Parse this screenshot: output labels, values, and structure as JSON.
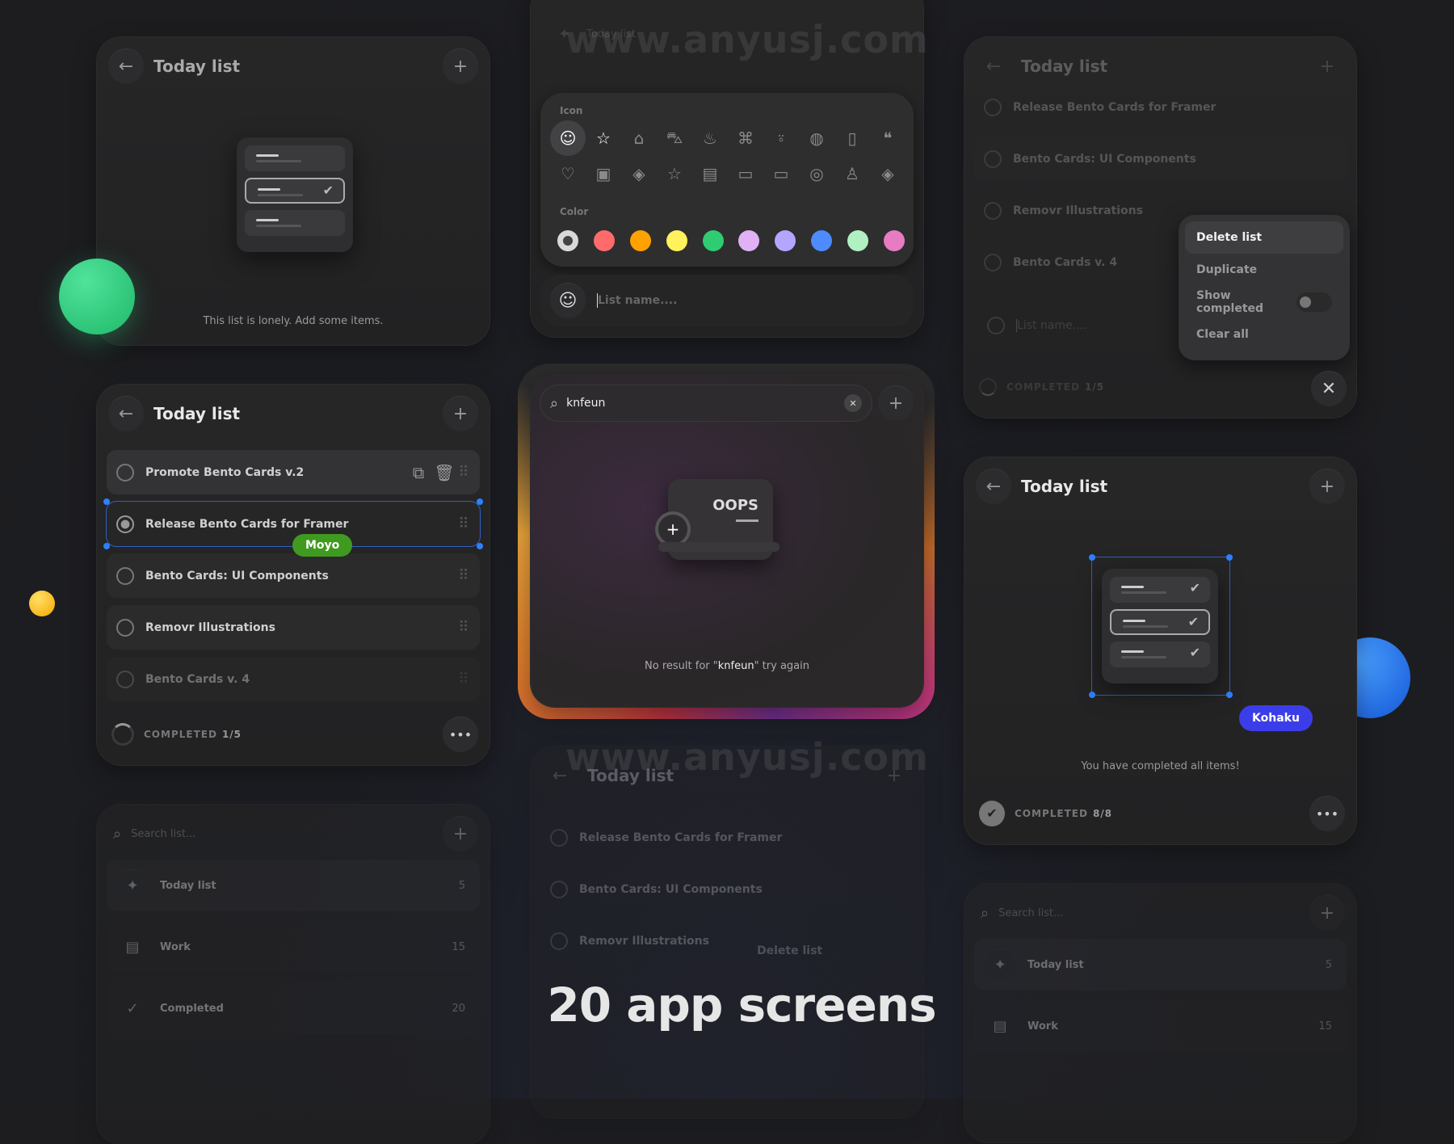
{
  "common": {
    "list_title": "Today list",
    "back_icon": "arrow-left-icon",
    "add_icon": "plus-icon",
    "more_icon": "ellipsis-icon"
  },
  "empty_card": {
    "message": "This list is lonely. Add some items."
  },
  "picker": {
    "header_title": "Today list",
    "icon_label": "Icon",
    "color_label": "Color",
    "icons": [
      "smile",
      "star",
      "home",
      "car",
      "flame",
      "command",
      "user-check",
      "planet",
      "sd-card",
      "quote",
      "heart",
      "image",
      "compass",
      "star-outline",
      "sticky-note",
      "laptop",
      "laptop-2",
      "disc",
      "user",
      "compass-2"
    ],
    "colors": [
      "#d9d9d9",
      "#ff6b6b",
      "#ffa200",
      "#fff25c",
      "#2fcc71",
      "#e0b2f5",
      "#b3a6ff",
      "#4d8bff",
      "#b1f0c1",
      "#e77cc2"
    ],
    "selected_icon": "smile",
    "name_placeholder": "List name...."
  },
  "menu_card": {
    "items": [
      "Release Bento Cards for Framer",
      "Bento Cards: UI Components",
      "Removr Illustrations",
      "Bento Cards v. 4"
    ],
    "input_placeholder": "List name....",
    "completed_label": "COMPLETED",
    "completed_value": "1/5",
    "menu": {
      "delete": "Delete list",
      "duplicate": "Duplicate",
      "show_completed": "Show completed",
      "show_completed_on": false,
      "clear": "Clear all"
    }
  },
  "list_card": {
    "items": [
      {
        "label": "Promote Bento Cards v.2",
        "done": false
      },
      {
        "label": "Release Bento Cards for Framer",
        "done": false
      },
      {
        "label": "Bento Cards: UI Components",
        "done": false
      },
      {
        "label": "Removr Illustrations",
        "done": false
      },
      {
        "label": "Bento Cards v. 4",
        "done": false
      }
    ],
    "collaborator": "Moyo",
    "collaborator_color": "#3f9a1f",
    "completed_label": "COMPLETED",
    "completed_value": "1/5",
    "progress": 0.2
  },
  "search_card": {
    "query": "knfeun",
    "oops": "OOPS",
    "result_prefix": "No result for \"",
    "result_query": "knfeun",
    "result_suffix": "\" try again"
  },
  "done_card": {
    "message": "You have completed all items!",
    "collaborator": "Kohaku",
    "collaborator_color": "#3b3ee8",
    "completed_label": "COMPLETED",
    "completed_value": "8/8",
    "progress": 1
  },
  "lists_card": {
    "search_placeholder": "Search list...",
    "lists": [
      {
        "name": "Today list",
        "count": "5"
      },
      {
        "name": "Work",
        "count": "15"
      },
      {
        "name": "Completed",
        "count": "20"
      }
    ]
  },
  "faded_center": {
    "items": [
      "Release Bento Cards for Framer",
      "Bento Cards: UI Components",
      "Removr Illustrations"
    ],
    "menu_item": "Delete list"
  },
  "lists_card_2": {
    "search_placeholder": "Search list...",
    "lists": [
      {
        "name": "Today list",
        "count": "5"
      },
      {
        "name": "Work",
        "count": "15"
      }
    ]
  },
  "headline": "20 app screens",
  "watermark": "www.anyusj.com"
}
